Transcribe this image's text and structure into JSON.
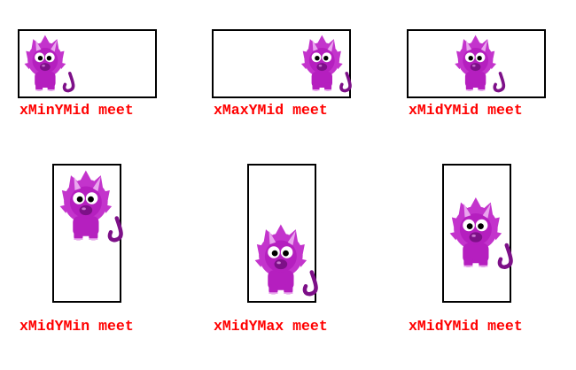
{
  "colors": {
    "caption": "#ff0000",
    "frame": "#000000",
    "body": "#b51fbf",
    "body_dark": "#7d1088",
    "spike": "#c334cc",
    "horn": "#e9a6ee",
    "eye_white": "#ffffff",
    "pupil": "#000000",
    "background": "#ffffff"
  },
  "diagram": {
    "title": "",
    "panels": [
      {
        "id": "xMinYMid",
        "caption": "xMinYMid meet",
        "align_x": "min",
        "align_y": "mid",
        "orientation": "wide"
      },
      {
        "id": "xMaxYMid",
        "caption": "xMaxYMid meet",
        "align_x": "max",
        "align_y": "mid",
        "orientation": "wide"
      },
      {
        "id": "xMidYMid-wide",
        "caption": "xMidYMid meet",
        "align_x": "mid",
        "align_y": "mid",
        "orientation": "wide"
      },
      {
        "id": "xMidYMin",
        "caption": "xMidYMin meet",
        "align_x": "mid",
        "align_y": "min",
        "orientation": "tall"
      },
      {
        "id": "xMidYMax",
        "caption": "xMidYMax meet",
        "align_x": "mid",
        "align_y": "max",
        "orientation": "tall"
      },
      {
        "id": "xMidYMid-tall",
        "caption": "xMidYMid meet",
        "align_x": "mid",
        "align_y": "mid",
        "orientation": "tall"
      }
    ]
  },
  "icons": {
    "creature": "dinosaur-icon"
  }
}
